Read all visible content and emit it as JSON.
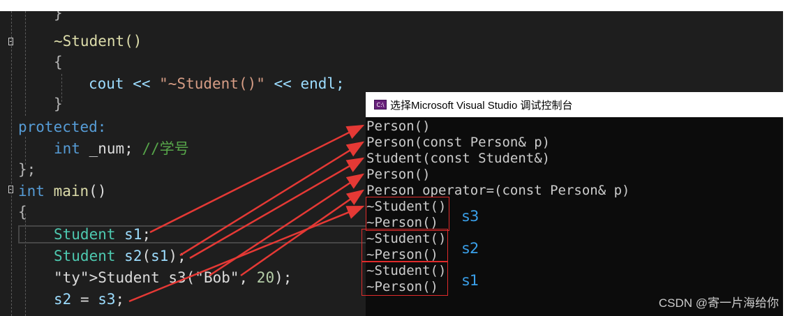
{
  "editor": {
    "lines": [
      [
        "}"
      ],
      [
        "~Student()"
      ],
      [
        "{"
      ],
      [
        "cout << \"~Student()\" << endl;"
      ],
      [
        "}"
      ],
      [
        "protected:"
      ],
      [
        "int _num; //学号"
      ],
      [
        "};"
      ],
      [
        "int main()"
      ],
      [
        "{"
      ],
      [
        "Student s1;"
      ],
      [
        "Student s2(s1);"
      ],
      [
        "Student s3(\"Bob\", 20);"
      ],
      [
        "s2 = s3;"
      ]
    ]
  },
  "console": {
    "title": "选择Microsoft Visual Studio 调试控制台",
    "icon_text": "C:\\",
    "output": [
      "Person()",
      "Person(const Person& p)",
      "Student(const Student&)",
      "Person()",
      "Person operator=(const Person& p)",
      "~Student()",
      "~Person()",
      "~Student()",
      "~Person()",
      "~Student()",
      "~Person()"
    ],
    "labels": [
      "s3",
      "s2",
      "s1"
    ]
  },
  "watermark": "CSDN @寄一片海给你",
  "colors": {
    "editor_bg": "#1e1e1e",
    "console_bg": "#0c0c0c",
    "arrow": "#e53935",
    "label": "#3aa0ea"
  }
}
